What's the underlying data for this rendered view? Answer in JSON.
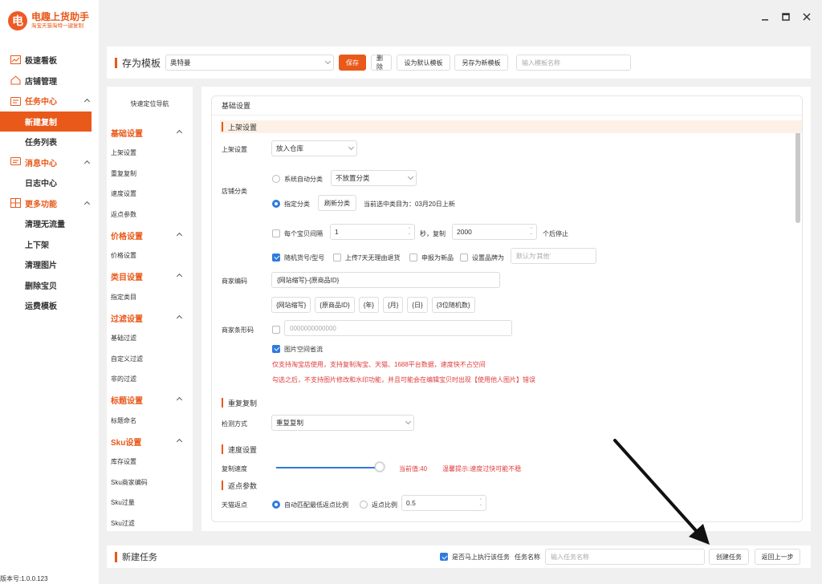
{
  "app": {
    "title": "电趣上货助手",
    "subtitle": "淘宝天猫淘特一键复制",
    "logo_char": "电",
    "version": "版本号:1.0.0.123"
  },
  "sidebar": {
    "items": [
      {
        "type": "group",
        "label": "极速看板",
        "icon": "chart-icon",
        "orange": false
      },
      {
        "type": "group",
        "label": "店铺管理",
        "icon": "home-icon",
        "orange": false
      },
      {
        "type": "group",
        "label": "任务中心",
        "icon": "task-icon",
        "orange": true,
        "chev": true
      },
      {
        "type": "item",
        "label": "新建复制",
        "active": true
      },
      {
        "type": "item",
        "label": "任务列表"
      },
      {
        "type": "group",
        "label": "消息中心",
        "icon": "message-icon",
        "orange": true,
        "chev": true
      },
      {
        "type": "item",
        "label": "日志中心"
      },
      {
        "type": "group",
        "label": "更多功能",
        "icon": "grid-icon",
        "orange": true,
        "chev": true
      },
      {
        "type": "item",
        "label": "清理无流量"
      },
      {
        "type": "item",
        "label": "上下架"
      },
      {
        "type": "item",
        "label": "清理图片"
      },
      {
        "type": "item",
        "label": "删除宝贝"
      },
      {
        "type": "item",
        "label": "运费模板"
      }
    ]
  },
  "topbar": {
    "title": "存为模板",
    "template_value": "奥特曼",
    "save": "保存",
    "delete": "删除",
    "set_default": "设为默认模板",
    "save_as": "另存为新模板",
    "name_placeholder": "输入模板名称"
  },
  "leftnav": {
    "header": "快速定位导航",
    "sections": [
      {
        "title": "基础设置",
        "items": [
          "上架设置",
          "重复复制",
          "速度设置",
          "返点参数"
        ]
      },
      {
        "title": "价格设置",
        "items": [
          "价格设置"
        ]
      },
      {
        "title": "类目设置",
        "items": [
          "指定类目"
        ]
      },
      {
        "title": "过滤设置",
        "items": [
          "基础过滤",
          "自定义过滤",
          "非的过滤"
        ]
      },
      {
        "title": "标题设置",
        "items": [
          "标题命名"
        ]
      },
      {
        "title": "Sku设置",
        "items": [
          "库存设置",
          "Sku商家编码",
          "Sku过量",
          "Sku过滤"
        ]
      }
    ]
  },
  "main": {
    "card_title": "基础设置",
    "shelf": {
      "title": "上架设置",
      "label": "上架设置",
      "value": "放入仓库"
    },
    "shop_cat": {
      "label": "店铺分类",
      "auto": "系统自动分类",
      "auto_value": "不放置分类",
      "assign": "指定分类",
      "refresh": "刷新分类",
      "current": "当前选中类目为：03月20日上新"
    },
    "interval": {
      "label1": "每个宝贝间隔",
      "v1": "1",
      "label2": "秒，复制",
      "v2": "2000",
      "label3": "个后停止"
    },
    "options": {
      "random": "随机货号/型号",
      "no_return": "上传7天无理由退货",
      "new": "申报为新品",
      "brand": "设置品牌为",
      "brand_placeholder": "默认为'其他'"
    },
    "merchant_code": {
      "label": "商家编码",
      "value": "{网站缩写}-{原商品ID}",
      "tags": [
        "{网站缩写}",
        "{原商品ID}",
        "{年}",
        "{月}",
        "{日}",
        "{3位随机数}"
      ]
    },
    "barcode": {
      "label": "商家条形码",
      "placeholder": "0000000000000"
    },
    "image_space": {
      "label": "图片空间省流",
      "note1": "仅支持淘宝店使用，支持复制淘宝、天猫、1688平台数据，速度快不占空间",
      "note2": "勾选之后，不支持图片修改和水印功能，并且可能会在编辑宝贝时出现【使用他人图片】错误"
    },
    "repeat": {
      "title": "重复复制",
      "label": "检测方式",
      "value": "重复复制"
    },
    "speed": {
      "title": "速度设置",
      "label": "复制速度",
      "current": "当前值:40",
      "hint": "温馨提示:速度过快可能不稳",
      "level": 40
    },
    "rebate": {
      "title": "返点参数",
      "label": "天猫返点",
      "auto": "自动匹配最低返点比例",
      "ratio": "返点比例",
      "ratio_value": "0.5"
    }
  },
  "bottombar": {
    "title": "新建任务",
    "exec_now": "是否马上执行该任务",
    "task_name": "任务名称",
    "task_placeholder": "输入任务名称",
    "create": "创建任务",
    "back": "返回上一步"
  },
  "colors": {
    "accent": "#e8591a",
    "blue": "#2e7bde",
    "red": "#e03a3a"
  }
}
